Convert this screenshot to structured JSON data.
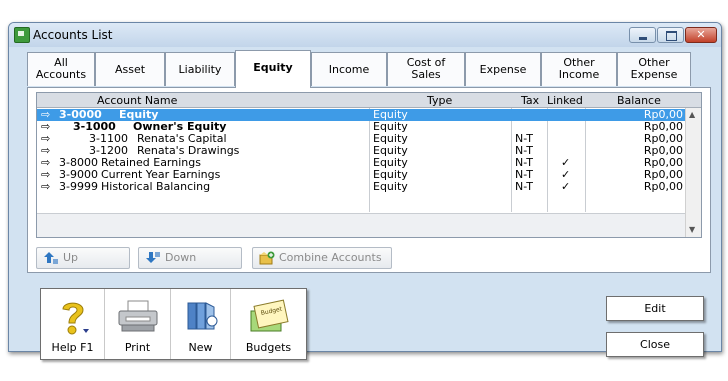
{
  "window": {
    "title": "Accounts List",
    "close_glyph": "✕"
  },
  "tabs": [
    {
      "label": "All Accounts",
      "l1": "All",
      "l2": "Accounts"
    },
    {
      "label": "Asset"
    },
    {
      "label": "Liability"
    },
    {
      "label": "Equity",
      "active": true
    },
    {
      "label": "Income"
    },
    {
      "label": "Cost of Sales",
      "l1": "Cost of",
      "l2": "Sales"
    },
    {
      "label": "Expense"
    },
    {
      "label": "Other Income",
      "l1": "Other",
      "l2": "Income"
    },
    {
      "label": "Other Expense",
      "l1": "Other",
      "l2": "Expense"
    }
  ],
  "grid": {
    "headers": {
      "name": "Account Name",
      "type": "Type",
      "tax": "Tax",
      "linked": "Linked",
      "balance": "Balance"
    },
    "rows": [
      {
        "arrow": "⇨",
        "num": "3-0000",
        "name": "Equity",
        "type": "Equity",
        "tax": "",
        "linked": "",
        "balance": "Rp0,00",
        "level": 0,
        "bold": true,
        "selected": true
      },
      {
        "arrow": "⇨",
        "num": "3-1000",
        "name": "Owner's Equity",
        "type": "Equity",
        "tax": "",
        "linked": "",
        "balance": "Rp0,00",
        "level": 1,
        "bold": true,
        "selected": false
      },
      {
        "arrow": "⇨",
        "num": "3-1100",
        "name": "Renata's Capital",
        "type": "Equity",
        "tax": "N-T",
        "linked": "",
        "balance": "Rp0,00",
        "level": 2,
        "bold": false,
        "selected": false
      },
      {
        "arrow": "⇨",
        "num": "3-1200",
        "name": "Renata's Drawings",
        "type": "Equity",
        "tax": "N-T",
        "linked": "",
        "balance": "Rp0,00",
        "level": 2,
        "bold": false,
        "selected": false
      },
      {
        "arrow": "⇨",
        "num": "3-8000",
        "name": "Retained Earnings",
        "type": "Equity",
        "tax": "N-T",
        "linked": "✓",
        "balance": "Rp0,00",
        "level": 0,
        "bold": false,
        "selected": false
      },
      {
        "arrow": "⇨",
        "num": "3-9000",
        "name": "Current Year Earnings",
        "type": "Equity",
        "tax": "N-T",
        "linked": "✓",
        "balance": "Rp0,00",
        "level": 0,
        "bold": false,
        "selected": false
      },
      {
        "arrow": "⇨",
        "num": "3-9999",
        "name": "Historical Balancing",
        "type": "Equity",
        "tax": "N-T",
        "linked": "✓",
        "balance": "Rp0,00",
        "level": 0,
        "bold": false,
        "selected": false
      }
    ]
  },
  "actions": {
    "up": "Up",
    "down": "Down",
    "combine": "Combine Accounts"
  },
  "toolbar": {
    "help": "Help F1",
    "print": "Print",
    "new": "New",
    "budgets": "Budgets",
    "budget_icon_text": "Budget"
  },
  "buttons": {
    "edit": "Edit",
    "close": "Close"
  },
  "colors": {
    "selection": "#3e9be7",
    "window_bg": "#d2e2f1"
  },
  "icons": [
    "app-icon",
    "minimize-icon",
    "maximize-icon",
    "close-icon",
    "arrow-right-icon",
    "up-icon",
    "down-icon",
    "combine-icon",
    "help-icon",
    "printer-icon",
    "new-icon",
    "budget-icon",
    "checkmark-icon"
  ]
}
